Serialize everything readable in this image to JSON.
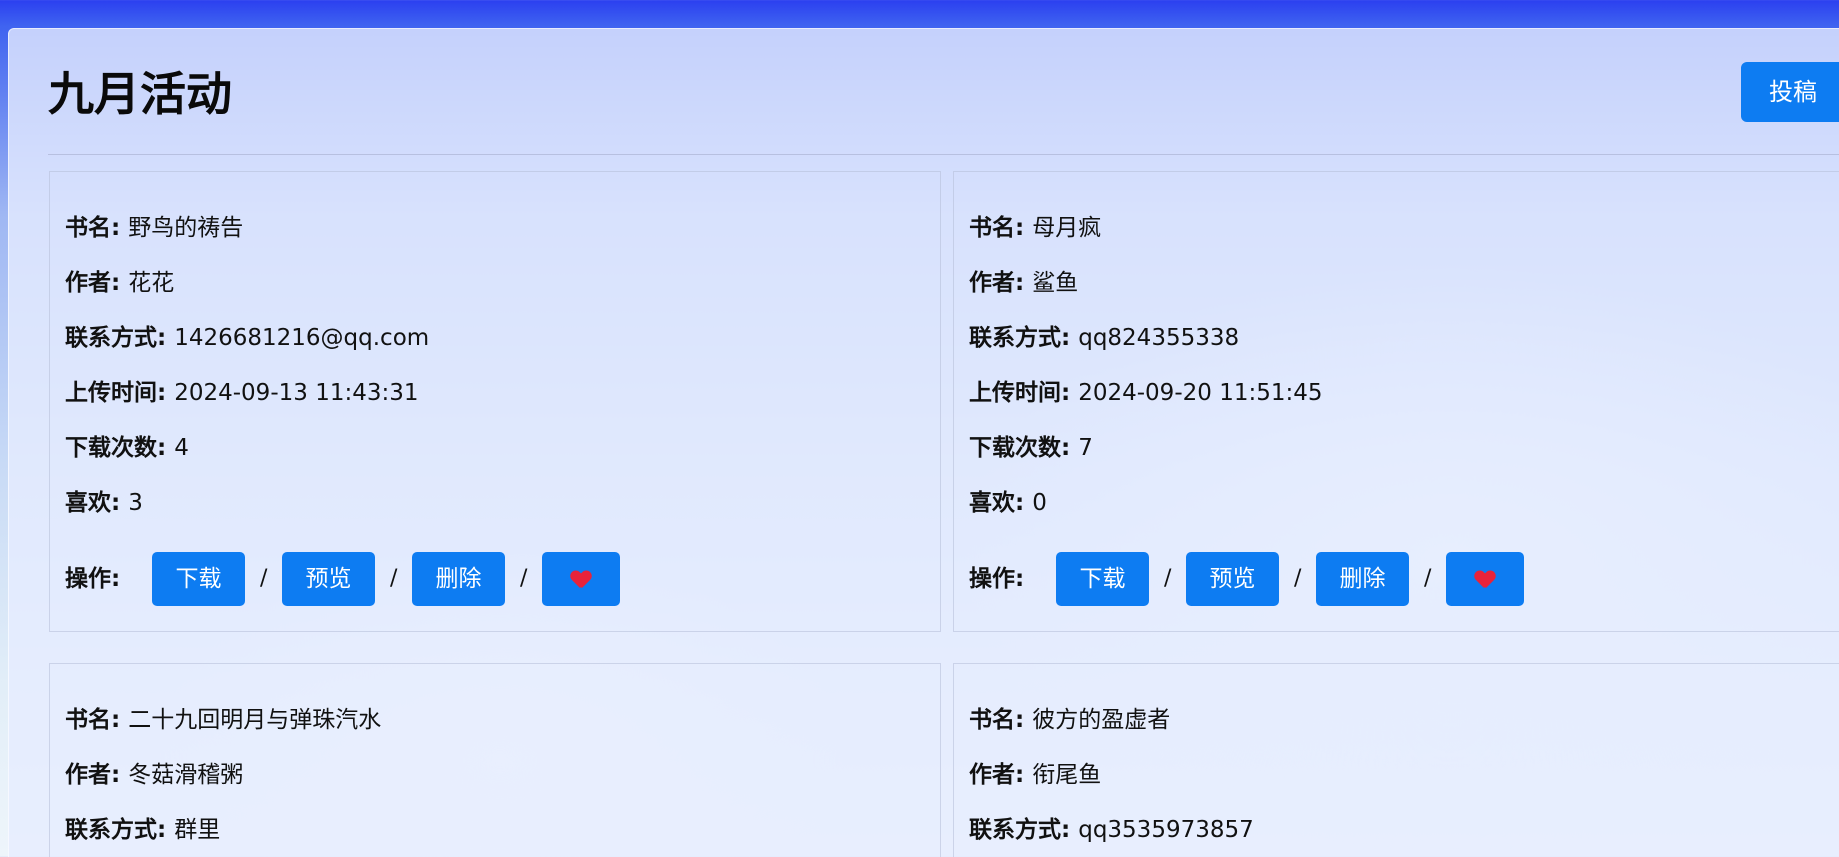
{
  "page": {
    "title": "九月活动",
    "submit_label": "投稿"
  },
  "labels": {
    "name": "书名",
    "author": "作者",
    "contact": "联系方式",
    "uploaded": "上传时间",
    "downloads": "下载次数",
    "likes": "喜欢",
    "actions": "操作:",
    "separator": "/"
  },
  "actions": {
    "download": "下载",
    "preview": "预览",
    "delete": "删除",
    "like_icon": "heart-icon"
  },
  "books": [
    {
      "name": "野鸟的祷告",
      "author": "花花",
      "contact": "1426681216@qq.com",
      "uploaded": "2024-09-13 11:43:31",
      "downloads": "4",
      "likes": "3"
    },
    {
      "name": "母月疯",
      "author": "鲨鱼",
      "contact": "qq824355338",
      "uploaded": "2024-09-20 11:51:45",
      "downloads": "7",
      "likes": "0"
    },
    {
      "name": "二十九回明月与弹珠汽水",
      "author": "冬菇滑稽粥",
      "contact": "群里"
    },
    {
      "name": "彼方的盈虚者",
      "author": "衔尾鱼",
      "contact": "qq3535973857"
    }
  ],
  "colors": {
    "accent": "#0d7cf2",
    "heart": "#e8233b"
  }
}
